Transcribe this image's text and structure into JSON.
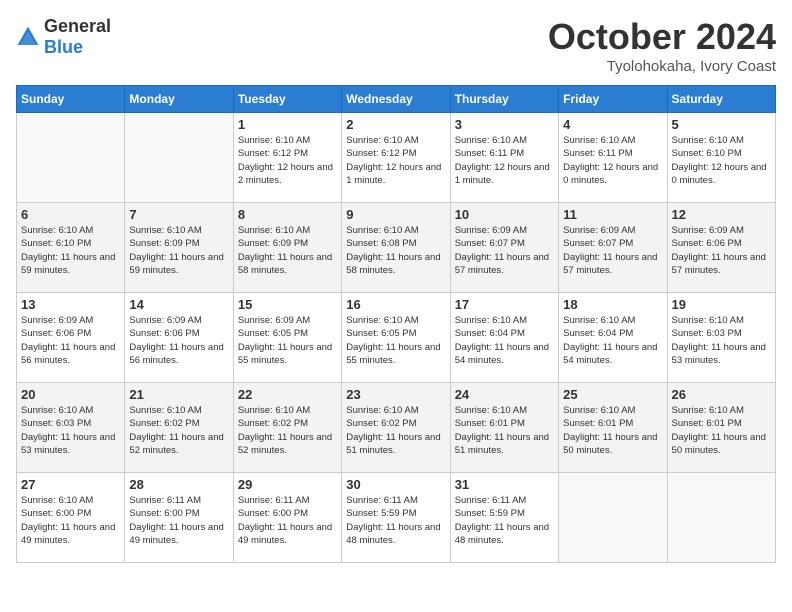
{
  "logo": {
    "general": "General",
    "blue": "Blue"
  },
  "header": {
    "month": "October 2024",
    "location": "Tyolohokaha, Ivory Coast"
  },
  "weekdays": [
    "Sunday",
    "Monday",
    "Tuesday",
    "Wednesday",
    "Thursday",
    "Friday",
    "Saturday"
  ],
  "weeks": [
    [
      null,
      null,
      {
        "day": "1",
        "sunrise": "Sunrise: 6:10 AM",
        "sunset": "Sunset: 6:12 PM",
        "daylight": "Daylight: 12 hours and 2 minutes."
      },
      {
        "day": "2",
        "sunrise": "Sunrise: 6:10 AM",
        "sunset": "Sunset: 6:12 PM",
        "daylight": "Daylight: 12 hours and 1 minute."
      },
      {
        "day": "3",
        "sunrise": "Sunrise: 6:10 AM",
        "sunset": "Sunset: 6:11 PM",
        "daylight": "Daylight: 12 hours and 1 minute."
      },
      {
        "day": "4",
        "sunrise": "Sunrise: 6:10 AM",
        "sunset": "Sunset: 6:11 PM",
        "daylight": "Daylight: 12 hours and 0 minutes."
      },
      {
        "day": "5",
        "sunrise": "Sunrise: 6:10 AM",
        "sunset": "Sunset: 6:10 PM",
        "daylight": "Daylight: 12 hours and 0 minutes."
      }
    ],
    [
      {
        "day": "6",
        "sunrise": "Sunrise: 6:10 AM",
        "sunset": "Sunset: 6:10 PM",
        "daylight": "Daylight: 11 hours and 59 minutes."
      },
      {
        "day": "7",
        "sunrise": "Sunrise: 6:10 AM",
        "sunset": "Sunset: 6:09 PM",
        "daylight": "Daylight: 11 hours and 59 minutes."
      },
      {
        "day": "8",
        "sunrise": "Sunrise: 6:10 AM",
        "sunset": "Sunset: 6:09 PM",
        "daylight": "Daylight: 11 hours and 58 minutes."
      },
      {
        "day": "9",
        "sunrise": "Sunrise: 6:10 AM",
        "sunset": "Sunset: 6:08 PM",
        "daylight": "Daylight: 11 hours and 58 minutes."
      },
      {
        "day": "10",
        "sunrise": "Sunrise: 6:09 AM",
        "sunset": "Sunset: 6:07 PM",
        "daylight": "Daylight: 11 hours and 57 minutes."
      },
      {
        "day": "11",
        "sunrise": "Sunrise: 6:09 AM",
        "sunset": "Sunset: 6:07 PM",
        "daylight": "Daylight: 11 hours and 57 minutes."
      },
      {
        "day": "12",
        "sunrise": "Sunrise: 6:09 AM",
        "sunset": "Sunset: 6:06 PM",
        "daylight": "Daylight: 11 hours and 57 minutes."
      }
    ],
    [
      {
        "day": "13",
        "sunrise": "Sunrise: 6:09 AM",
        "sunset": "Sunset: 6:06 PM",
        "daylight": "Daylight: 11 hours and 56 minutes."
      },
      {
        "day": "14",
        "sunrise": "Sunrise: 6:09 AM",
        "sunset": "Sunset: 6:06 PM",
        "daylight": "Daylight: 11 hours and 56 minutes."
      },
      {
        "day": "15",
        "sunrise": "Sunrise: 6:09 AM",
        "sunset": "Sunset: 6:05 PM",
        "daylight": "Daylight: 11 hours and 55 minutes."
      },
      {
        "day": "16",
        "sunrise": "Sunrise: 6:10 AM",
        "sunset": "Sunset: 6:05 PM",
        "daylight": "Daylight: 11 hours and 55 minutes."
      },
      {
        "day": "17",
        "sunrise": "Sunrise: 6:10 AM",
        "sunset": "Sunset: 6:04 PM",
        "daylight": "Daylight: 11 hours and 54 minutes."
      },
      {
        "day": "18",
        "sunrise": "Sunrise: 6:10 AM",
        "sunset": "Sunset: 6:04 PM",
        "daylight": "Daylight: 11 hours and 54 minutes."
      },
      {
        "day": "19",
        "sunrise": "Sunrise: 6:10 AM",
        "sunset": "Sunset: 6:03 PM",
        "daylight": "Daylight: 11 hours and 53 minutes."
      }
    ],
    [
      {
        "day": "20",
        "sunrise": "Sunrise: 6:10 AM",
        "sunset": "Sunset: 6:03 PM",
        "daylight": "Daylight: 11 hours and 53 minutes."
      },
      {
        "day": "21",
        "sunrise": "Sunrise: 6:10 AM",
        "sunset": "Sunset: 6:02 PM",
        "daylight": "Daylight: 11 hours and 52 minutes."
      },
      {
        "day": "22",
        "sunrise": "Sunrise: 6:10 AM",
        "sunset": "Sunset: 6:02 PM",
        "daylight": "Daylight: 11 hours and 52 minutes."
      },
      {
        "day": "23",
        "sunrise": "Sunrise: 6:10 AM",
        "sunset": "Sunset: 6:02 PM",
        "daylight": "Daylight: 11 hours and 51 minutes."
      },
      {
        "day": "24",
        "sunrise": "Sunrise: 6:10 AM",
        "sunset": "Sunset: 6:01 PM",
        "daylight": "Daylight: 11 hours and 51 minutes."
      },
      {
        "day": "25",
        "sunrise": "Sunrise: 6:10 AM",
        "sunset": "Sunset: 6:01 PM",
        "daylight": "Daylight: 11 hours and 50 minutes."
      },
      {
        "day": "26",
        "sunrise": "Sunrise: 6:10 AM",
        "sunset": "Sunset: 6:01 PM",
        "daylight": "Daylight: 11 hours and 50 minutes."
      }
    ],
    [
      {
        "day": "27",
        "sunrise": "Sunrise: 6:10 AM",
        "sunset": "Sunset: 6:00 PM",
        "daylight": "Daylight: 11 hours and 49 minutes."
      },
      {
        "day": "28",
        "sunrise": "Sunrise: 6:11 AM",
        "sunset": "Sunset: 6:00 PM",
        "daylight": "Daylight: 11 hours and 49 minutes."
      },
      {
        "day": "29",
        "sunrise": "Sunrise: 6:11 AM",
        "sunset": "Sunset: 6:00 PM",
        "daylight": "Daylight: 11 hours and 49 minutes."
      },
      {
        "day": "30",
        "sunrise": "Sunrise: 6:11 AM",
        "sunset": "Sunset: 5:59 PM",
        "daylight": "Daylight: 11 hours and 48 minutes."
      },
      {
        "day": "31",
        "sunrise": "Sunrise: 6:11 AM",
        "sunset": "Sunset: 5:59 PM",
        "daylight": "Daylight: 11 hours and 48 minutes."
      },
      null,
      null
    ]
  ]
}
